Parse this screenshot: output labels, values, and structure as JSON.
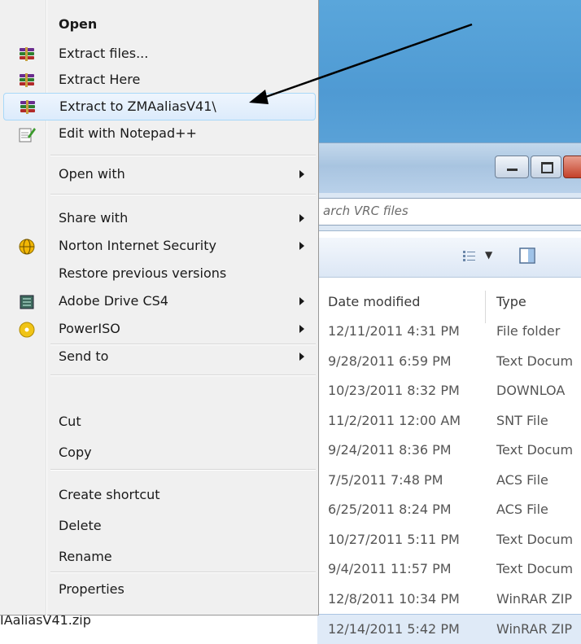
{
  "menu": {
    "items": [
      {
        "label": "Open",
        "bold": true,
        "icon": ""
      },
      {
        "label": "Extract files...",
        "icon": "winrar-books-icon"
      },
      {
        "label": "Extract Here",
        "icon": "winrar-books-icon"
      },
      {
        "label": "Extract to ZMAaliasV41\\",
        "icon": "winrar-books-icon",
        "highlighted": true
      },
      {
        "label": "Edit with Notepad++",
        "icon": "notepad-plus-icon"
      },
      {
        "label": "Open with",
        "submenu": true
      },
      {
        "label": "Share with",
        "submenu": true
      },
      {
        "label": "Norton Internet Security",
        "icon": "norton-globe-icon",
        "submenu": true
      },
      {
        "label": "Restore previous versions"
      },
      {
        "label": "Adobe Drive CS4",
        "icon": "adobe-drive-icon",
        "submenu": true
      },
      {
        "label": "PowerISO",
        "icon": "poweriso-disc-icon",
        "submenu": true
      },
      {
        "label": "Send to",
        "submenu": true
      },
      {
        "label": "Cut"
      },
      {
        "label": "Copy"
      },
      {
        "label": "Create shortcut"
      },
      {
        "label": "Delete"
      },
      {
        "label": "Rename"
      },
      {
        "label": "Properties"
      }
    ]
  },
  "explorer": {
    "search_placeholder": "arch VRC files",
    "columns": {
      "date": "Date modified",
      "type": "Type"
    },
    "rows": [
      {
        "date": "12/11/2011 4:31 PM",
        "type": "File folder"
      },
      {
        "date": "9/28/2011 6:59 PM",
        "type": "Text Docum"
      },
      {
        "date": "10/23/2011 8:32 PM",
        "type": "DOWNLOA"
      },
      {
        "date": "11/2/2011 12:00 AM",
        "type": "SNT File"
      },
      {
        "date": "9/24/2011 8:36 PM",
        "type": "Text Docum"
      },
      {
        "date": "7/5/2011 7:48 PM",
        "type": "ACS File"
      },
      {
        "date": "6/25/2011 8:24 PM",
        "type": "ACS File"
      },
      {
        "date": "10/27/2011 5:11 PM",
        "type": "Text Docum"
      },
      {
        "date": "9/4/2011 11:57 PM",
        "type": "Text Docum"
      },
      {
        "date": "12/8/2011 10:34 PM",
        "type": "WinRAR ZIP"
      },
      {
        "date": "12/14/2011 5:42 PM",
        "type": "WinRAR ZIP",
        "selected": true
      }
    ],
    "selected_filename": "IAaliasV41.zip"
  },
  "colors": {
    "menu_bg": "#f0f0f0",
    "hover_border": "#a8d8f8",
    "desktop_blue": "#4f9ad3"
  }
}
